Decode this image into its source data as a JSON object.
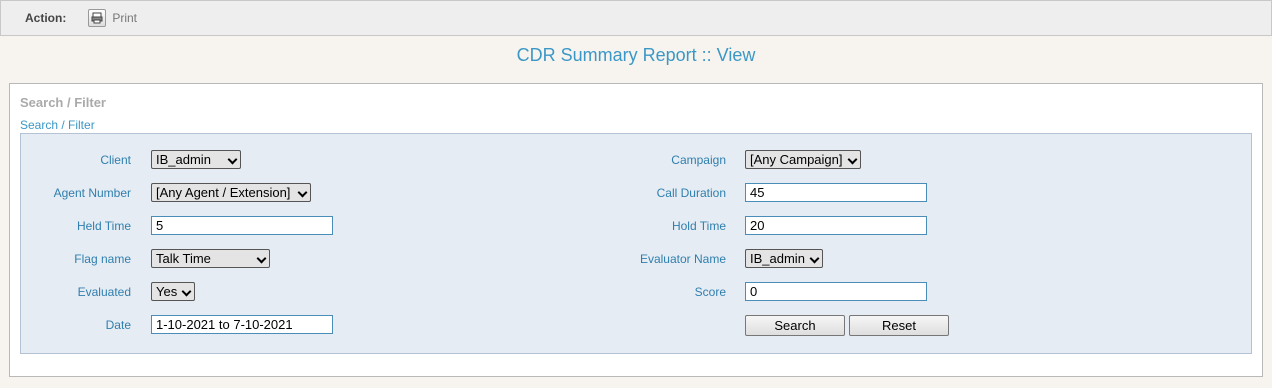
{
  "actionbar": {
    "label": "Action:",
    "print_label": "Print",
    "print_icon": "print-icon"
  },
  "page": {
    "title": "CDR Summary Report :: View"
  },
  "panel": {
    "heading": "Search / Filter",
    "link": "Search / Filter"
  },
  "filters": {
    "client": {
      "label": "Client",
      "value": "IB_admin"
    },
    "agent_number": {
      "label": "Agent Number",
      "value": "[Any Agent / Extension]"
    },
    "held_time": {
      "label": "Held Time",
      "value": "5"
    },
    "flag_name": {
      "label": "Flag name",
      "value": "Talk Time"
    },
    "evaluated": {
      "label": "Evaluated",
      "value": "Yes"
    },
    "date": {
      "label": "Date",
      "value": "1-10-2021 to 7-10-2021"
    },
    "campaign": {
      "label": "Campaign",
      "value": "[Any Campaign]"
    },
    "call_duration": {
      "label": "Call Duration",
      "value": "45"
    },
    "hold_time": {
      "label": "Hold Time",
      "value": "20"
    },
    "evaluator_name": {
      "label": "Evaluator Name",
      "value": "IB_admin"
    },
    "score": {
      "label": "Score",
      "value": "0"
    }
  },
  "buttons": {
    "search": "Search",
    "reset": "Reset"
  },
  "colors": {
    "accent": "#3b98c6",
    "label": "#2f7fae",
    "filter_bg": "#e6ecf3"
  }
}
